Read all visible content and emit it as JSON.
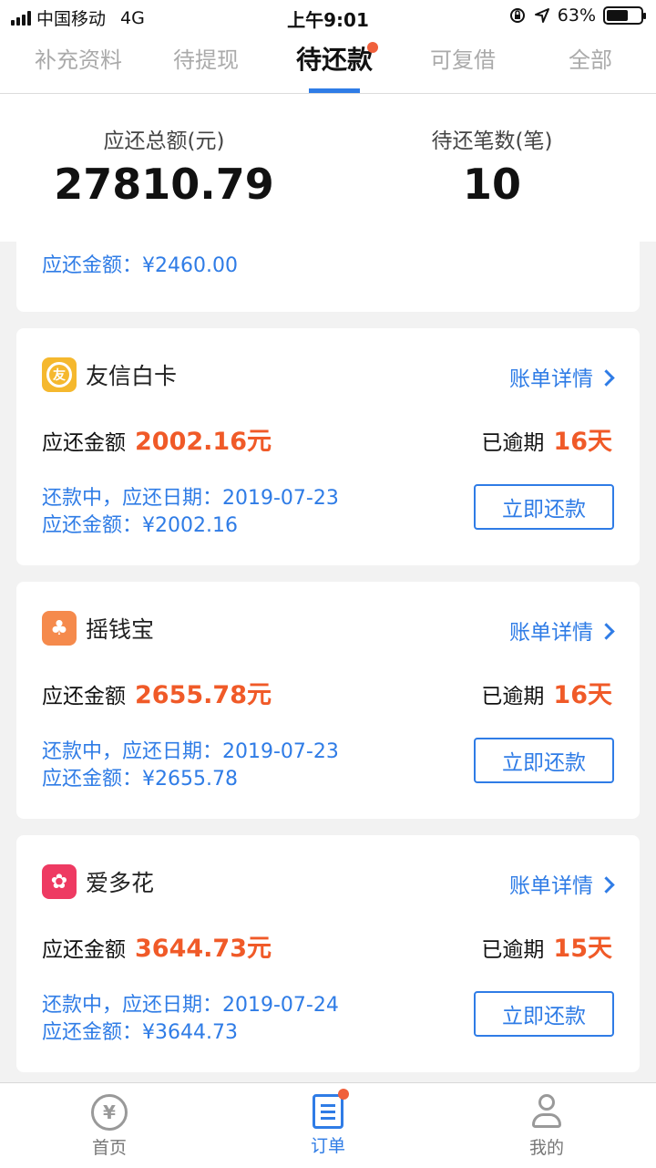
{
  "status": {
    "carrier": "中国移动",
    "network": "4G",
    "time": "上午9:01",
    "battery": "63%",
    "battery_level": 0.63
  },
  "tabs": [
    {
      "label": "补充资料"
    },
    {
      "label": "待提现"
    },
    {
      "label": "待还款"
    },
    {
      "label": "可复借"
    },
    {
      "label": "全部"
    }
  ],
  "summary": {
    "total_label": "应还总额(元)",
    "total_value": "27810.79",
    "count_label": "待还笔数(笔)",
    "count_value": "10"
  },
  "partial_card": {
    "info_line2": "应还金额：¥2460.00"
  },
  "cards": [
    {
      "name": "友信白卡",
      "logo_char": "友",
      "logo_color": "#f5b82e",
      "detail_label": "账单详情",
      "amount_label": "应还金额",
      "amount": "2002.16元",
      "overdue_label": "已逾期",
      "overdue_days": "16天",
      "info_line1": "还款中，应还日期：2019-07-23",
      "info_line2": "应还金额：¥2002.16",
      "button": "立即还款"
    },
    {
      "name": "摇钱宝",
      "logo_char": "♣",
      "logo_color": "#f58a4c",
      "detail_label": "账单详情",
      "amount_label": "应还金额",
      "amount": "2655.78元",
      "overdue_label": "已逾期",
      "overdue_days": "16天",
      "info_line1": "还款中，应还日期：2019-07-23",
      "info_line2": "应还金额：¥2655.78",
      "button": "立即还款"
    },
    {
      "name": "爱多花",
      "logo_char": "✿",
      "logo_color": "#ee3a62",
      "detail_label": "账单详情",
      "amount_label": "应还金额",
      "amount": "3644.73元",
      "overdue_label": "已逾期",
      "overdue_days": "15天",
      "info_line1": "还款中，应还日期：2019-07-24",
      "info_line2": "应还金额：¥3644.73",
      "button": "立即还款"
    }
  ],
  "nav": [
    {
      "label": "首页",
      "icon": "yuan-icon"
    },
    {
      "label": "订单",
      "icon": "order-icon"
    },
    {
      "label": "我的",
      "icon": "person-icon"
    }
  ],
  "colors": {
    "accent": "#2f7ce6",
    "alert": "#f05a28"
  }
}
